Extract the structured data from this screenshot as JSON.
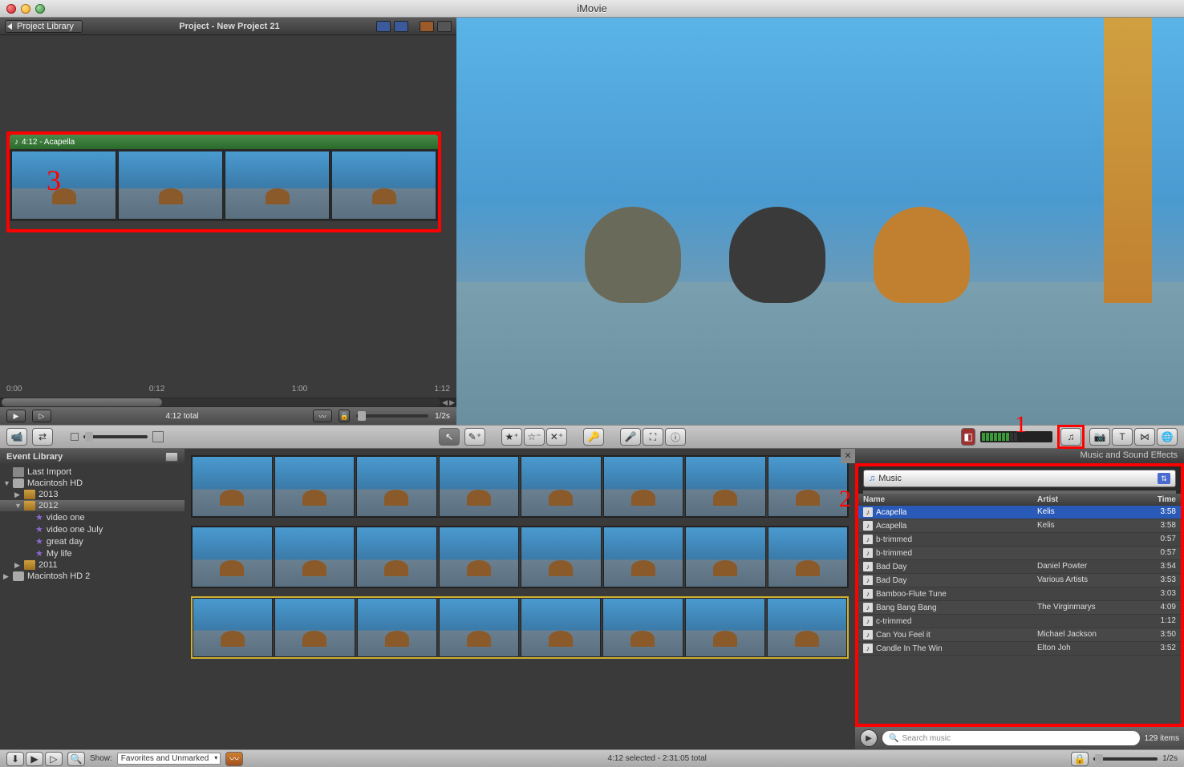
{
  "window": {
    "title": "iMovie"
  },
  "project_header": {
    "back": "Project Library",
    "title": "Project - New Project 21"
  },
  "clip": {
    "audio_label": "4:12 - Acapella",
    "annotation_3": "3"
  },
  "timeline": {
    "t0": "0:00",
    "t1": "0:12",
    "t2": "1:00",
    "t3": "1:12"
  },
  "project_footer": {
    "total": "4:12 total",
    "zoom": "1/2s"
  },
  "annotation_1": "1",
  "annotation_2": "2",
  "event_header": "Event Library",
  "event_tree": [
    {
      "label": "Last Import",
      "icon": "cam",
      "indent": 0,
      "disc": ""
    },
    {
      "label": "Macintosh HD",
      "icon": "hd",
      "indent": 0,
      "disc": "▼"
    },
    {
      "label": "2013",
      "icon": "cal",
      "indent": 1,
      "disc": "▶"
    },
    {
      "label": "2012",
      "icon": "cal",
      "indent": 1,
      "disc": "▼",
      "sel": true
    },
    {
      "label": "video one",
      "icon": "star",
      "indent": 2,
      "disc": ""
    },
    {
      "label": "video one July",
      "icon": "star",
      "indent": 2,
      "disc": ""
    },
    {
      "label": "great day",
      "icon": "star",
      "indent": 2,
      "disc": ""
    },
    {
      "label": "My life",
      "icon": "star",
      "indent": 2,
      "disc": ""
    },
    {
      "label": "2011",
      "icon": "cal",
      "indent": 1,
      "disc": "▶"
    },
    {
      "label": "Macintosh HD 2",
      "icon": "hd",
      "indent": 0,
      "disc": "▶"
    }
  ],
  "music": {
    "panel_title": "Music and Sound Effects",
    "source": "Music",
    "col_name": "Name",
    "col_artist": "Artist",
    "col_time": "Time",
    "rows": [
      {
        "name": "Acapella",
        "artist": "Kelis",
        "time": "3:58",
        "sel": true
      },
      {
        "name": "Acapella",
        "artist": "Kelis",
        "time": "3:58"
      },
      {
        "name": "b-trimmed",
        "artist": "",
        "time": "0:57"
      },
      {
        "name": "b-trimmed",
        "artist": "",
        "time": "0:57"
      },
      {
        "name": "Bad Day",
        "artist": "Daniel Powter",
        "time": "3:54"
      },
      {
        "name": "Bad Day",
        "artist": "Various Artists",
        "time": "3:53"
      },
      {
        "name": "Bamboo-Flute Tune",
        "artist": "",
        "time": "3:03"
      },
      {
        "name": "Bang Bang Bang",
        "artist": "The Virginmarys",
        "time": "4:09"
      },
      {
        "name": "c-trimmed",
        "artist": "",
        "time": "1:12"
      },
      {
        "name": "Can You Feel it",
        "artist": "Michael Jackson",
        "time": "3:50"
      },
      {
        "name": "Candle In The Win",
        "artist": "Elton Joh",
        "time": "3:52"
      }
    ],
    "search_placeholder": "Search music",
    "count": "129 items"
  },
  "status": {
    "show_label": "Show:",
    "show_value": "Favorites and Unmarked",
    "selected": "4:12 selected - 2:31:05 total",
    "zoom": "1/2s"
  }
}
